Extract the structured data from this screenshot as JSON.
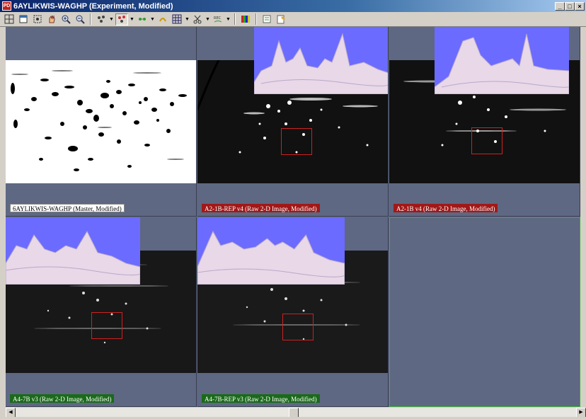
{
  "window": {
    "title": "6AYLIKWIS-WAGHP (Experiment, Modified)",
    "app_icon": "app-icon",
    "buttons": [
      "minimize",
      "maximize",
      "close"
    ]
  },
  "toolbar": {
    "items": [
      {
        "icon": "grid-view-icon"
      },
      {
        "icon": "window-icon"
      },
      {
        "icon": "select-region-icon"
      },
      {
        "icon": "hand-pan-icon"
      },
      {
        "icon": "zoom-in-icon"
      },
      {
        "icon": "zoom-out-icon"
      },
      {
        "icon": "spot-detect-icon"
      },
      {
        "icon": "spot-edit-icon",
        "pressed": true
      },
      {
        "icon": "spot-match-icon"
      },
      {
        "icon": "spot-link-icon"
      },
      {
        "icon": "grid-icon"
      },
      {
        "icon": "scissors-icon"
      },
      {
        "icon": "rec-label-icon"
      },
      {
        "icon": "color-bars-icon"
      },
      {
        "icon": "report-icon"
      },
      {
        "icon": "notes-icon"
      }
    ]
  },
  "panes": [
    {
      "label": "6AYLIKWIS-WAGHP (Master, Modified)",
      "style": "white"
    },
    {
      "label": "A2-1B-REP v4 (Raw 2-D Image, Modified)",
      "style": "red"
    },
    {
      "label": "A2-1B v4 (Raw 2-D Image, Modified)",
      "style": "red"
    },
    {
      "label": "A4-7B v3 (Raw 2-D Image, Modified)",
      "style": "green"
    },
    {
      "label": "A4-7B-REP v3 (Raw 2-D Image, Modified)",
      "style": "green"
    }
  ],
  "colors": {
    "workspace": "#5e6882",
    "surface_bg": "#6b6bff",
    "roi": "#d02020",
    "label_red": "#a01818",
    "label_green": "#1a6a1a"
  }
}
